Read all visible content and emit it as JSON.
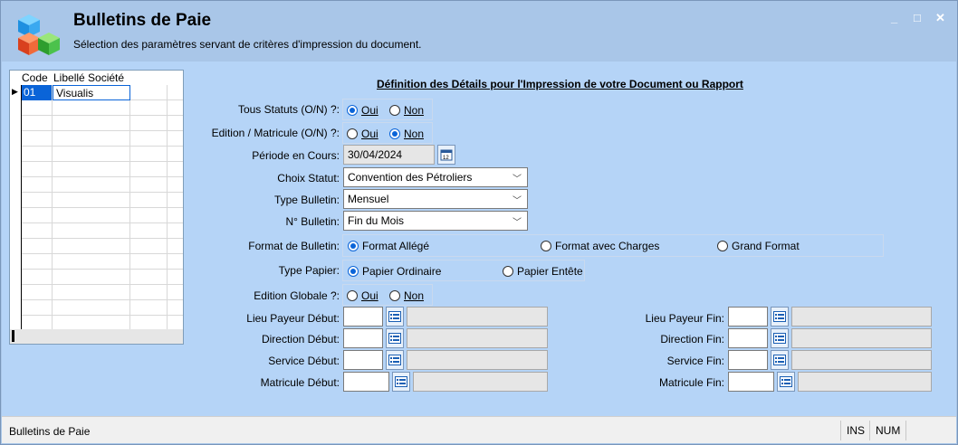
{
  "window": {
    "title": "Bulletins de Paie",
    "subtitle": "Sélection des paramètres servant de critères d'impression du document.",
    "minimize": "_",
    "maximize": "□",
    "close": "✕"
  },
  "grid": {
    "headers": {
      "code": "Code",
      "libelle": "Libellé Société"
    },
    "rows": [
      {
        "code": "01",
        "libelle": "Visualis"
      }
    ]
  },
  "form": {
    "section_title": "Définition des Détails pour l'Impression de votre Document ou Rapport",
    "tous_statuts": {
      "label": "Tous Statuts (O/N) ?:",
      "oui": "Oui",
      "non": "Non",
      "selected": "oui"
    },
    "edition_matricule": {
      "label": "Edition / Matricule (O/N) ?:",
      "oui": "Oui",
      "non": "Non",
      "selected": "non"
    },
    "periode": {
      "label": "Période en Cours:",
      "value": "30/04/2024"
    },
    "choix_statut": {
      "label": "Choix Statut:",
      "value": "Convention des Pétroliers"
    },
    "type_bulletin": {
      "label": "Type Bulletin:",
      "value": "Mensuel"
    },
    "n_bulletin": {
      "label": "N° Bulletin:",
      "value": "Fin du Mois"
    },
    "format_bulletin": {
      "label": "Format de Bulletin:",
      "opt1": "Format Allégé",
      "opt2": "Format  avec Charges",
      "opt3": "Grand Format",
      "selected": "opt1"
    },
    "type_papier": {
      "label": "Type Papier:",
      "opt1": "Papier Ordinaire",
      "opt2": "Papier Entête",
      "selected": "opt1"
    },
    "edition_globale": {
      "label": "Edition Globale ?:",
      "oui": "Oui",
      "non": "Non",
      "selected": "oui"
    },
    "lieu_payeur_debut": "Lieu Payeur Début:",
    "direction_debut": "Direction Début:",
    "service_debut": "Service Début:",
    "matricule_debut": "Matricule Début:",
    "lieu_payeur_fin": "Lieu Payeur Fin:",
    "direction_fin": "Direction Fin:",
    "service_fin": "Service Fin:",
    "matricule_fin": "Matricule Fin:"
  },
  "statusbar": {
    "text": "Bulletins de Paie",
    "ins": "INS",
    "num": "NUM"
  }
}
